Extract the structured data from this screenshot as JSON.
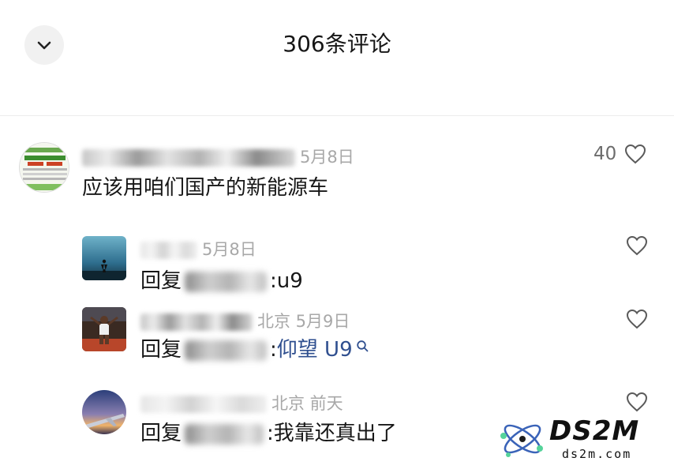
{
  "header": {
    "title": "306条评论",
    "collapse_icon": "chevron-down-icon"
  },
  "comments": [
    {
      "meta": "5月8日",
      "text": "应该用咱们国产的新能源车",
      "like_count": "40",
      "avatar": "green-white-banner"
    }
  ],
  "replies": [
    {
      "meta": "5月8日",
      "prefix": "回复",
      "text": ":u9",
      "avatar": "dusk-figure-silhouette"
    },
    {
      "meta": "北京 5月9日",
      "prefix": "回复",
      "text": ":",
      "link": "仰望 U9",
      "avatar": "runner-track-photo"
    },
    {
      "meta": "北京 前天",
      "prefix": "回复",
      "text": ":我靠还真出了",
      "avatar": "sunset-airplane-wing"
    }
  ],
  "watermark": {
    "brand": "DS2M",
    "domain": "ds2m.com"
  },
  "colors": {
    "link": "#2f4f8f",
    "meta": "#a8a8a8",
    "text": "#171717"
  }
}
